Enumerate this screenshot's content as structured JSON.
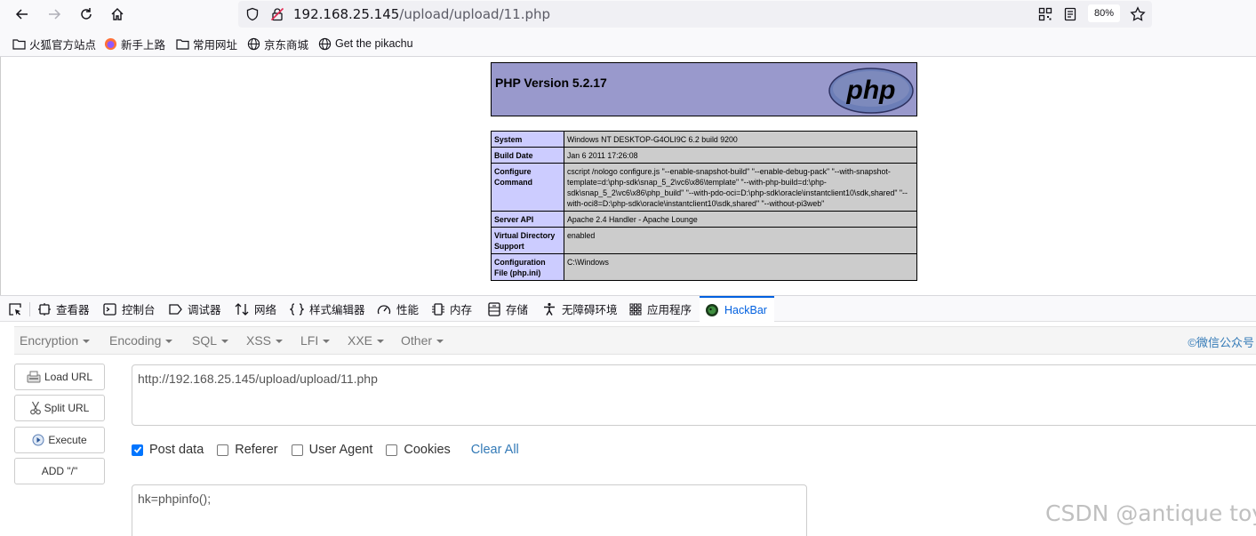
{
  "browser": {
    "url_host": "192.168.25.145",
    "url_path": "/upload/upload/11.php",
    "zoom": "80%"
  },
  "bookmarks": [
    {
      "label": "火狐官方站点",
      "icon": "folder-icon"
    },
    {
      "label": "新手上路",
      "icon": "firefox-icon"
    },
    {
      "label": "常用网址",
      "icon": "folder-icon"
    },
    {
      "label": "京东商城",
      "icon": "globe-icon"
    },
    {
      "label": "Get the pikachu",
      "icon": "globe-icon"
    }
  ],
  "phpinfo": {
    "version": "PHP Version 5.2.17",
    "logo_text": "php",
    "rows": [
      {
        "key": "System",
        "value": "Windows NT DESKTOP-G4OLI9C 6.2 build 9200"
      },
      {
        "key": "Build Date",
        "value": "Jan 6 2011 17:26:08"
      },
      {
        "key": "Configure Command",
        "value": "cscript /nologo configure.js \"--enable-snapshot-build\" \"--enable-debug-pack\" \"--with-snapshot-template=d:\\php-sdk\\snap_5_2\\vc6\\x86\\template\" \"--with-php-build=d:\\php-sdk\\snap_5_2\\vc6\\x86\\php_build\" \"--with-pdo-oci=D:\\php-sdk\\oracle\\instantclient10\\sdk,shared\" \"--with-oci8=D:\\php-sdk\\oracle\\instantclient10\\sdk,shared\" \"--without-pi3web\""
      },
      {
        "key": "Server API",
        "value": "Apache 2.4 Handler - Apache Lounge"
      },
      {
        "key": "Virtual Directory Support",
        "value": "enabled"
      },
      {
        "key": "Configuration File (php.ini)",
        "value": "C:\\Windows"
      }
    ]
  },
  "devtools": {
    "tabs": [
      {
        "label": "查看器",
        "icon": "inspector-icon"
      },
      {
        "label": "控制台",
        "icon": "console-icon"
      },
      {
        "label": "调试器",
        "icon": "debugger-icon"
      },
      {
        "label": "网络",
        "icon": "network-icon"
      },
      {
        "label": "样式编辑器",
        "icon": "style-editor-icon"
      },
      {
        "label": "性能",
        "icon": "performance-icon"
      },
      {
        "label": "内存",
        "icon": "memory-icon"
      },
      {
        "label": "存储",
        "icon": "storage-icon"
      },
      {
        "label": "无障碍环境",
        "icon": "accessibility-icon"
      },
      {
        "label": "应用程序",
        "icon": "application-icon"
      },
      {
        "label": "HackBar",
        "icon": "hackbar-icon"
      }
    ],
    "active_tab": "HackBar"
  },
  "hackbar": {
    "menu": [
      "Encryption",
      "Encoding",
      "SQL",
      "XSS",
      "LFI",
      "XXE",
      "Other"
    ],
    "credit": "©微信公众号",
    "buttons": {
      "load_url": "Load URL",
      "split_url": "Split URL",
      "execute": "Execute",
      "add_slash": "ADD \"/\""
    },
    "url_value": "http://192.168.25.145/upload/upload/11.php",
    "options": {
      "post_data": "Post data",
      "referer": "Referer",
      "user_agent": "User Agent",
      "cookies": "Cookies",
      "clear_all": "Clear All"
    },
    "post_value": "hk=phpinfo();"
  },
  "watermark": "CSDN @antique toy",
  "colors": {
    "php_header": "#9999cc",
    "php_key": "#ccccff",
    "php_value": "#cccccc",
    "accent": "#0060df",
    "link": "#337ab7"
  }
}
